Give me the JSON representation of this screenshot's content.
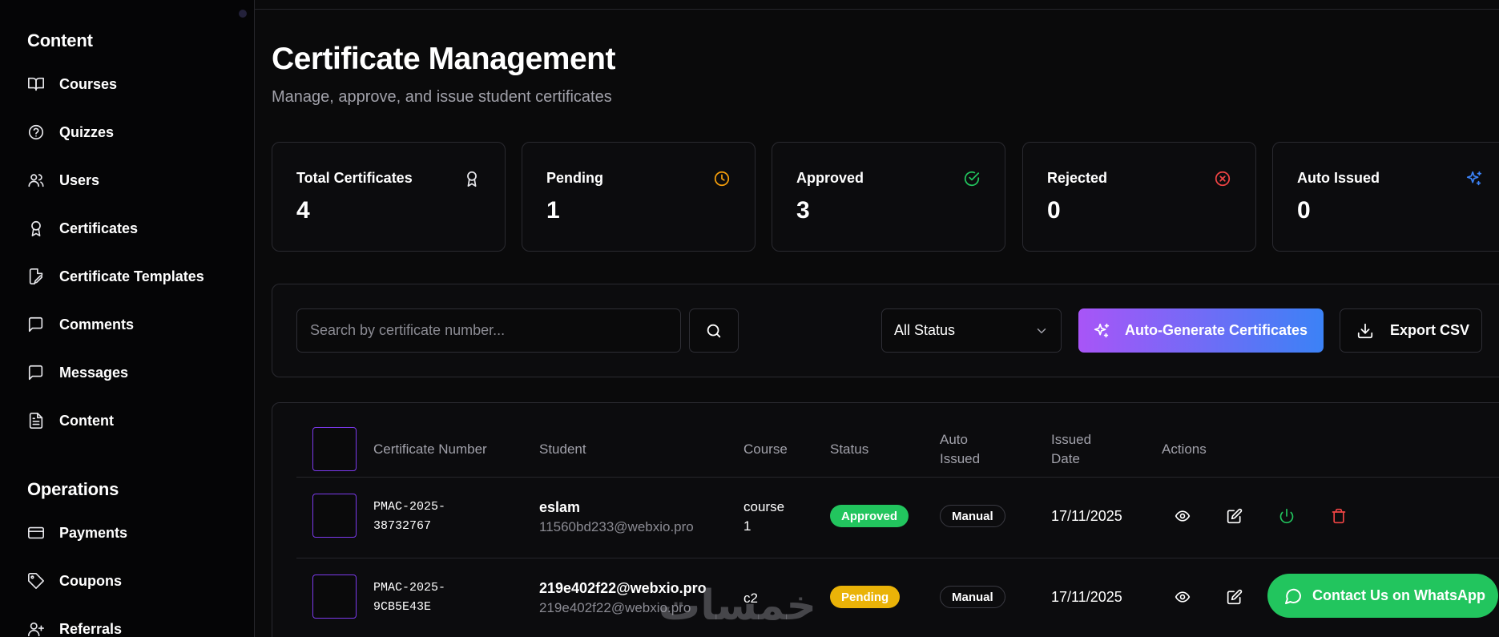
{
  "sidebar": {
    "sections": [
      {
        "title": "Content"
      },
      {
        "title": "Operations"
      }
    ],
    "content_items": [
      {
        "label": "Courses",
        "icon": "book-icon"
      },
      {
        "label": "Quizzes",
        "icon": "help-circle-icon"
      },
      {
        "label": "Users",
        "icon": "users-icon"
      },
      {
        "label": "Certificates",
        "icon": "award-icon"
      },
      {
        "label": "Certificate Templates",
        "icon": "file-edit-icon"
      },
      {
        "label": "Comments",
        "icon": "message-square-icon"
      },
      {
        "label": "Messages",
        "icon": "message-square-icon"
      },
      {
        "label": "Content",
        "icon": "file-text-icon"
      }
    ],
    "operations_items": [
      {
        "label": "Payments",
        "icon": "credit-card-icon"
      },
      {
        "label": "Coupons",
        "icon": "tag-icon"
      },
      {
        "label": "Referrals",
        "icon": "user-plus-icon"
      }
    ]
  },
  "header": {
    "title": "Certificate Management",
    "subtitle": "Manage, approve, and issue student certificates"
  },
  "stats": [
    {
      "label": "Total Certificates",
      "value": "4",
      "icon": "award-icon",
      "color": "#e6e6ea"
    },
    {
      "label": "Pending",
      "value": "1",
      "icon": "clock-icon",
      "color": "#f59e0b"
    },
    {
      "label": "Approved",
      "value": "3",
      "icon": "check-circle-icon",
      "color": "#22c55e"
    },
    {
      "label": "Rejected",
      "value": "0",
      "icon": "x-circle-icon",
      "color": "#ef4444"
    },
    {
      "label": "Auto Issued",
      "value": "0",
      "icon": "sparkles-icon",
      "color": "#3b82f6"
    }
  ],
  "toolbar": {
    "search_placeholder": "Search by certificate number...",
    "status_filter": "All Status",
    "auto_generate_label": "Auto-Generate Certificates",
    "export_label": "Export CSV"
  },
  "table": {
    "columns": [
      "Certificate Number",
      "Student",
      "Course",
      "Status",
      "Auto\nIssued",
      "Issued\nDate",
      "Actions"
    ],
    "rows": [
      {
        "cert_number": "PMAC-2025-\n38732767",
        "student_name": "eslam",
        "student_email": "11560bd233@webxio.pro",
        "course": "course\n1",
        "status": "Approved",
        "auto_issued": "Manual",
        "issued_date": "17/11/2025"
      },
      {
        "cert_number": "PMAC-2025-\n9CB5E43E",
        "student_name": "219e402f22@webxio.pro",
        "student_email": "219e402f22@webxio.pro",
        "course": "c2",
        "status": "Pending",
        "auto_issued": "Manual",
        "issued_date": "17/11/2025"
      }
    ]
  },
  "whatsapp": {
    "label": "Contact Us on WhatsApp"
  },
  "watermark": {
    "text": "خمسات"
  },
  "colors": {
    "accent_purple": "#a855f7",
    "accent_blue": "#3b82f6",
    "success": "#22c55e",
    "warning": "#eab308",
    "danger": "#ef4444"
  }
}
